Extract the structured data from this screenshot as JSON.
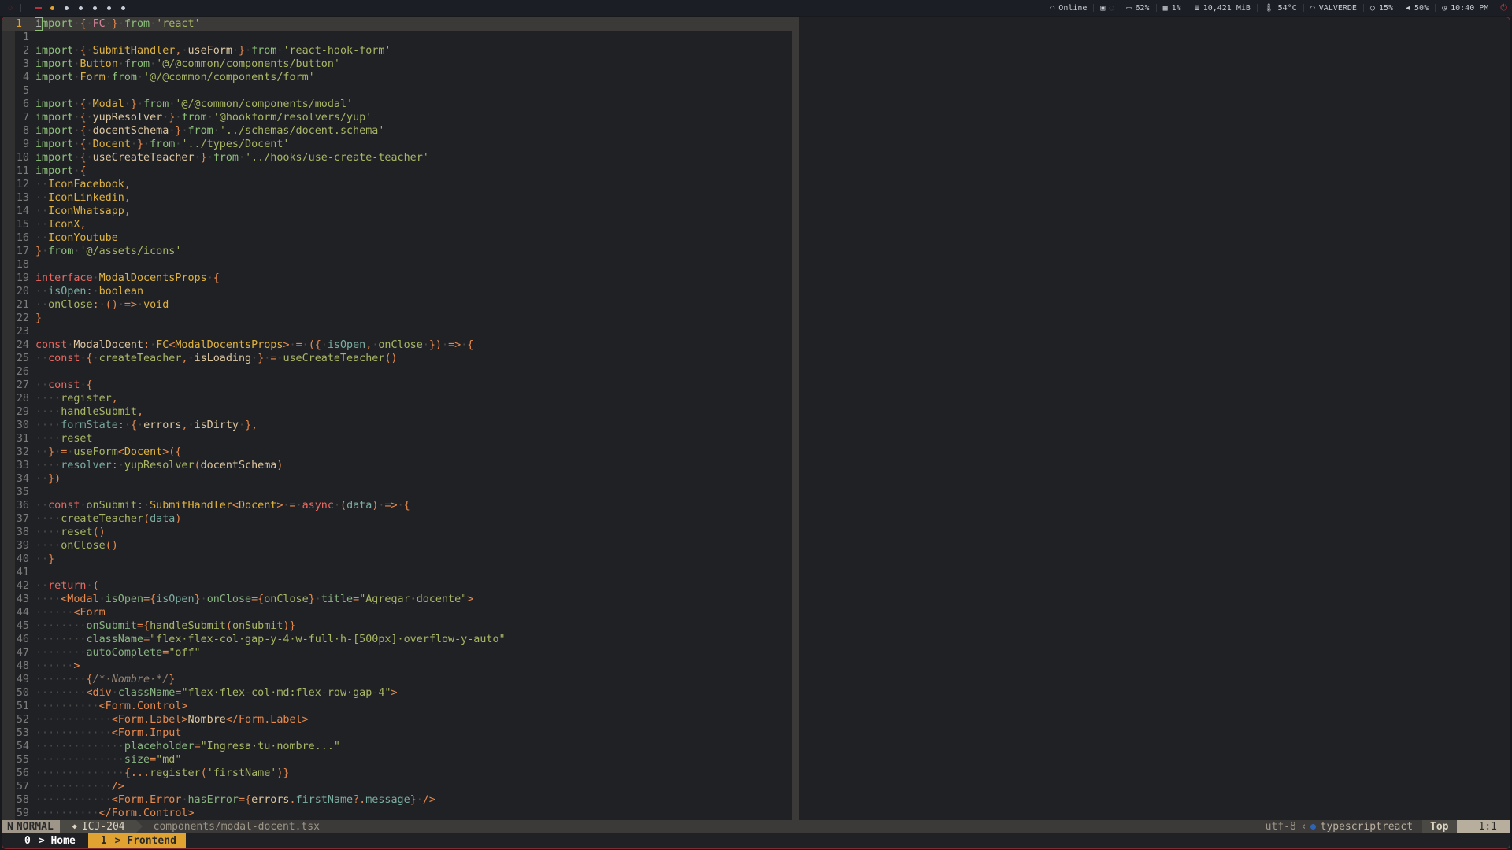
{
  "topbar": {
    "workspaces": [
      {
        "type": "dash",
        "active": false
      },
      {
        "type": "dot",
        "active": true
      },
      {
        "type": "dot",
        "active": false
      },
      {
        "type": "dot",
        "active": false
      },
      {
        "type": "dot",
        "active": false
      },
      {
        "type": "dot",
        "active": false
      },
      {
        "type": "dot",
        "active": false
      }
    ],
    "network_status": "Online",
    "battery": "62%",
    "cpu": "1%",
    "memory": "10,421 MiB",
    "temperature": "54°C",
    "wifi_name": "VALVERDE",
    "brightness": "15%",
    "volume": "50%",
    "clock": "10:40 PM"
  },
  "editor": {
    "current_line_number": "1",
    "lines": [
      {
        "n": "1",
        "cur": true,
        "html": "<span class='cursor'>i</span><span class='kw'>mport</span><span class='ws-d'>·</span><span class='br'>{</span><span class='ws-d'>·</span><span class='fc'>FC</span><span class='ws-d'>·</span><span class='br'>}</span><span class='ws-d'>·</span><span class='kw'>from</span><span class='ws-d'>·</span><span class='st'>'react'</span>"
      },
      {
        "n": "1",
        "html": ""
      },
      {
        "n": "2",
        "html": "<span class='kw'>import</span><span class='ws-d'>·</span><span class='br'>{</span><span class='ws-d'>·</span><span class='ty'>SubmitHandler</span><span class='br'>,</span><span class='ws-d'>·</span><span class='id'>useForm</span><span class='ws-d'>·</span><span class='br'>}</span><span class='ws-d'>·</span><span class='kw'>from</span><span class='ws-d'>·</span><span class='st'>'react-hook-form'</span>"
      },
      {
        "n": "3",
        "html": "<span class='kw'>import</span><span class='ws-d'>·</span><span class='ty'>Button</span><span class='ws-d'>·</span><span class='kw'>from</span><span class='ws-d'>·</span><span class='st'>'@/@common/components/button'</span>"
      },
      {
        "n": "4",
        "html": "<span class='kw'>import</span><span class='ws-d'>·</span><span class='ty'>Form</span><span class='ws-d'>·</span><span class='kw'>from</span><span class='ws-d'>·</span><span class='st'>'@/@common/components/form'</span>"
      },
      {
        "n": "5",
        "html": ""
      },
      {
        "n": "6",
        "html": "<span class='kw'>import</span><span class='ws-d'>·</span><span class='br'>{</span><span class='ws-d'>·</span><span class='ty'>Modal</span><span class='ws-d'>·</span><span class='br'>}</span><span class='ws-d'>·</span><span class='kw'>from</span><span class='ws-d'>·</span><span class='st'>'@/@common/components/modal'</span>"
      },
      {
        "n": "7",
        "html": "<span class='kw'>import</span><span class='ws-d'>·</span><span class='br'>{</span><span class='ws-d'>·</span><span class='id'>yupResolver</span><span class='ws-d'>·</span><span class='br'>}</span><span class='ws-d'>·</span><span class='kw'>from</span><span class='ws-d'>·</span><span class='st'>'@hookform/resolvers/yup'</span>"
      },
      {
        "n": "8",
        "html": "<span class='kw'>import</span><span class='ws-d'>·</span><span class='br'>{</span><span class='ws-d'>·</span><span class='id'>docentSchema</span><span class='ws-d'>·</span><span class='br'>}</span><span class='ws-d'>·</span><span class='kw'>from</span><span class='ws-d'>·</span><span class='st'>'../schemas/docent.schema'</span>"
      },
      {
        "n": "9",
        "html": "<span class='kw'>import</span><span class='ws-d'>·</span><span class='br'>{</span><span class='ws-d'>·</span><span class='ty'>Docent</span><span class='ws-d'>·</span><span class='br'>}</span><span class='ws-d'>·</span><span class='kw'>from</span><span class='ws-d'>·</span><span class='st'>'../types/Docent'</span>"
      },
      {
        "n": "10",
        "html": "<span class='kw'>import</span><span class='ws-d'>·</span><span class='br'>{</span><span class='ws-d'>·</span><span class='id'>useCreateTeacher</span><span class='ws-d'>·</span><span class='br'>}</span><span class='ws-d'>·</span><span class='kw'>from</span><span class='ws-d'>·</span><span class='st'>'../hooks/use-create-teacher'</span>"
      },
      {
        "n": "11",
        "html": "<span class='kw'>import</span><span class='ws-d'>·</span><span class='br'>{</span>"
      },
      {
        "n": "12",
        "html": "<span class='ws-d'>··</span><span class='ty'>IconFacebook</span><span class='br'>,</span>"
      },
      {
        "n": "13",
        "html": "<span class='ws-d'>··</span><span class='ty'>IconLinkedin</span><span class='br'>,</span>"
      },
      {
        "n": "14",
        "html": "<span class='ws-d'>··</span><span class='ty'>IconWhatsapp</span><span class='br'>,</span>"
      },
      {
        "n": "15",
        "html": "<span class='ws-d'>··</span><span class='ty'>IconX</span><span class='br'>,</span>"
      },
      {
        "n": "16",
        "html": "<span class='ws-d'>··</span><span class='ty'>IconYoutube</span>"
      },
      {
        "n": "17",
        "html": "<span class='br'>}</span><span class='ws-d'>·</span><span class='kw'>from</span><span class='ws-d'>·</span><span class='st'>'@/assets/icons'</span>"
      },
      {
        "n": "18",
        "html": ""
      },
      {
        "n": "19",
        "html": "<span class='kr'>interface</span><span class='ws-d'>·</span><span class='ty'>ModalDocentsProps</span><span class='ws-d'>·</span><span class='br'>{</span>"
      },
      {
        "n": "20",
        "html": "<span class='ws-d'>··</span><span class='pr'>isOpen</span><span class='br'>:</span><span class='ws-d'>·</span><span class='ty'>boolean</span>"
      },
      {
        "n": "21",
        "html": "<span class='ws-d'>··</span><span class='fn'>onClose</span><span class='br'>:</span><span class='ws-d'>·</span><span class='br'>()</span><span class='ws-d'>·</span><span class='br'>=&gt;</span><span class='ws-d'>·</span><span class='ty'>void</span>"
      },
      {
        "n": "22",
        "html": "<span class='br'>}</span>"
      },
      {
        "n": "23",
        "html": ""
      },
      {
        "n": "24",
        "html": "<span class='kr'>const</span><span class='ws-d'>·</span><span class='id'>ModalDocent</span><span class='br'>:</span><span class='ws-d'>·</span><span class='ty'>FC</span><span class='br'>&lt;</span><span class='ty'>ModalDocentsProps</span><span class='br'>&gt;</span><span class='ws-d'>·</span><span class='br'>=</span><span class='ws-d'>·</span><span class='br'>({</span><span class='ws-d'>·</span><span class='pr'>isOpen</span><span class='br'>,</span><span class='ws-d'>·</span><span class='fn'>onClose</span><span class='ws-d'>·</span><span class='br'>})</span><span class='ws-d'>·</span><span class='br'>=&gt;</span><span class='ws-d'>·</span><span class='br'>{</span>"
      },
      {
        "n": "25",
        "html": "<span class='ws-d'>··</span><span class='kr'>const</span><span class='ws-d'>·</span><span class='br'>{</span><span class='ws-d'>·</span><span class='fn'>createTeacher</span><span class='br'>,</span><span class='ws-d'>·</span><span class='id'>isLoading</span><span class='ws-d'>·</span><span class='br'>}</span><span class='ws-d'>·</span><span class='br'>=</span><span class='ws-d'>·</span><span class='fn'>useCreateTeacher</span><span class='br'>()</span>"
      },
      {
        "n": "26",
        "html": ""
      },
      {
        "n": "27",
        "html": "<span class='ws-d'>··</span><span class='kr'>const</span><span class='ws-d'>·</span><span class='br'>{</span>"
      },
      {
        "n": "28",
        "html": "<span class='ws-d'>····</span><span class='fn'>register</span><span class='br'>,</span>"
      },
      {
        "n": "29",
        "html": "<span class='ws-d'>····</span><span class='fn'>handleSubmit</span><span class='br'>,</span>"
      },
      {
        "n": "30",
        "html": "<span class='ws-d'>····</span><span class='pr'>formState</span><span class='br'>:</span><span class='ws-d'>·</span><span class='br'>{</span><span class='ws-d'>·</span><span class='id'>errors</span><span class='br'>,</span><span class='ws-d'>·</span><span class='id'>isDirty</span><span class='ws-d'>·</span><span class='br'>},</span>"
      },
      {
        "n": "31",
        "html": "<span class='ws-d'>····</span><span class='fn'>reset</span>"
      },
      {
        "n": "32",
        "html": "<span class='ws-d'>··</span><span class='br'>}</span><span class='ws-d'>·</span><span class='br'>=</span><span class='ws-d'>·</span><span class='fn'>useForm</span><span class='br'>&lt;</span><span class='ty'>Docent</span><span class='br'>&gt;({</span>"
      },
      {
        "n": "33",
        "html": "<span class='ws-d'>····</span><span class='pr'>resolver</span><span class='br'>:</span><span class='ws-d'>·</span><span class='fn'>yupResolver</span><span class='br'>(</span><span class='id'>docentSchema</span><span class='br'>)</span>"
      },
      {
        "n": "34",
        "html": "<span class='ws-d'>··</span><span class='br'>})</span>"
      },
      {
        "n": "35",
        "html": ""
      },
      {
        "n": "36",
        "html": "<span class='ws-d'>··</span><span class='kr'>const</span><span class='ws-d'>·</span><span class='fn'>onSubmit</span><span class='br'>:</span><span class='ws-d'>·</span><span class='ty'>SubmitHandler</span><span class='br'>&lt;</span><span class='ty'>Docent</span><span class='br'>&gt;</span><span class='ws-d'>·</span><span class='br'>=</span><span class='ws-d'>·</span><span class='kr'>async</span><span class='ws-d'>·</span><span class='br'>(</span><span class='pr'>data</span><span class='br'>)</span><span class='ws-d'>·</span><span class='br'>=&gt;</span><span class='ws-d'>·</span><span class='br'>{</span>"
      },
      {
        "n": "37",
        "html": "<span class='ws-d'>····</span><span class='fn'>createTeacher</span><span class='br'>(</span><span class='pr'>data</span><span class='br'>)</span>"
      },
      {
        "n": "38",
        "html": "<span class='ws-d'>····</span><span class='fn'>reset</span><span class='br'>()</span>"
      },
      {
        "n": "39",
        "html": "<span class='ws-d'>····</span><span class='fn'>onClose</span><span class='br'>()</span>"
      },
      {
        "n": "40",
        "html": "<span class='ws-d'>··</span><span class='br'>}</span>"
      },
      {
        "n": "41",
        "html": ""
      },
      {
        "n": "42",
        "html": "<span class='ws-d'>··</span><span class='kr'>return</span><span class='ws-d'>·</span><span class='br'>(</span>"
      },
      {
        "n": "43",
        "html": "<span class='ws-d'>····</span><span class='tg'>&lt;Modal</span><span class='ws-d'>·</span><span class='at'>isOpen</span><span class='br'>={</span><span class='pr'>isOpen</span><span class='br'>}</span><span class='ws-d'>·</span><span class='at'>onClose</span><span class='br'>={</span><span class='fn'>onClose</span><span class='br'>}</span><span class='ws-d'>·</span><span class='at'>title</span><span class='br'>=</span><span class='st'>\"Agregar·docente\"</span><span class='tg'>&gt;</span>"
      },
      {
        "n": "44",
        "html": "<span class='ws-d'>······</span><span class='tg'>&lt;Form</span>"
      },
      {
        "n": "45",
        "html": "<span class='ws-d'>········</span><span class='at'>onSubmit</span><span class='br'>={</span><span class='fn'>handleSubmit</span><span class='br'>(</span><span class='fn'>onSubmit</span><span class='br'>)}</span>"
      },
      {
        "n": "46",
        "html": "<span class='ws-d'>········</span><span class='at'>className</span><span class='br'>=</span><span class='st'>\"flex·flex-col·gap-y-4·w-full·h-[500px]·overflow-y-auto\"</span>"
      },
      {
        "n": "47",
        "html": "<span class='ws-d'>········</span><span class='at'>autoComplete</span><span class='br'>=</span><span class='st'>\"off\"</span>"
      },
      {
        "n": "48",
        "html": "<span class='ws-d'>······</span><span class='tg'>&gt;</span>"
      },
      {
        "n": "49",
        "html": "<span class='ws-d'>········</span><span class='br'>{</span><span class='cm'>/*·Nombre·*/</span><span class='br'>}</span>"
      },
      {
        "n": "50",
        "html": "<span class='ws-d'>········</span><span class='tg'>&lt;div</span><span class='ws-d'>·</span><span class='at'>className</span><span class='br'>=</span><span class='st'>\"flex·flex-col·md:flex-row·gap-4\"</span><span class='tg'>&gt;</span>"
      },
      {
        "n": "51",
        "html": "<span class='ws-d'>··········</span><span class='tg'>&lt;Form.Control&gt;</span>"
      },
      {
        "n": "52",
        "html": "<span class='ws-d'>············</span><span class='tg'>&lt;Form.Label&gt;</span><span class='id'>Nombre</span><span class='tg'>&lt;/Form.Label&gt;</span>"
      },
      {
        "n": "53",
        "html": "<span class='ws-d'>············</span><span class='tg'>&lt;Form.Input</span>"
      },
      {
        "n": "54",
        "html": "<span class='ws-d'>··············</span><span class='at'>placeholder</span><span class='br'>=</span><span class='st'>\"Ingresa·tu·nombre...\"</span>"
      },
      {
        "n": "55",
        "html": "<span class='ws-d'>··············</span><span class='at'>size</span><span class='br'>=</span><span class='st'>\"md\"</span>"
      },
      {
        "n": "56",
        "html": "<span class='ws-d'>··············</span><span class='br'>{...</span><span class='fn'>register</span><span class='br'>(</span><span class='st'>'firstName'</span><span class='br'>)}</span>"
      },
      {
        "n": "57",
        "html": "<span class='ws-d'>············</span><span class='tg'>/&gt;</span>"
      },
      {
        "n": "58",
        "html": "<span class='ws-d'>············</span><span class='tg'>&lt;Form.Error</span><span class='ws-d'>·</span><span class='at'>hasError</span><span class='br'>={</span><span class='id'>errors</span><span class='br'>.</span><span class='pr'>firstName</span><span class='br'>?.</span><span class='pr'>message</span><span class='br'>}</span><span class='ws-d'>·</span><span class='tg'>/&gt;</span>"
      },
      {
        "n": "59",
        "html": "<span class='ws-d'>··········</span><span class='tg'>&lt;/Form.Control&gt;</span>"
      }
    ]
  },
  "statusline": {
    "mode_icon": "N",
    "mode": "NORMAL",
    "branch_icon": "◆",
    "branch": "ICJ-204",
    "file": "components/modal-docent.tsx",
    "encoding": "utf-8",
    "filetype": "typescriptreact",
    "scroll": "Top",
    "position": "1:1"
  },
  "tmux": {
    "windows": [
      {
        "index": "0",
        "name": "Home",
        "active": false
      },
      {
        "index": "1",
        "name": "Frontend",
        "active": true
      }
    ]
  }
}
